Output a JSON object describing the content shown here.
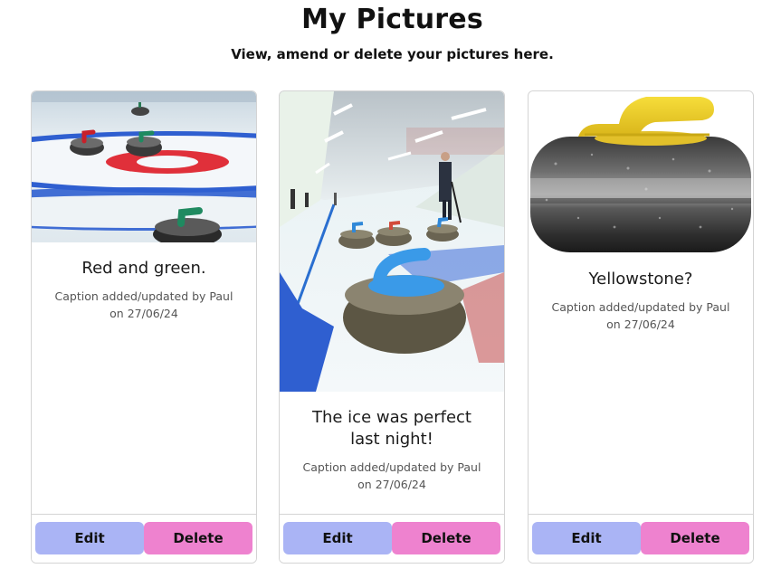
{
  "header": {
    "title": "My Pictures",
    "subtitle": "View, amend or delete your pictures here."
  },
  "cards": [
    {
      "image_icon": "curling-stones-red-green-photo",
      "caption": "Red and green.",
      "meta_line1": "Caption added/updated by Paul",
      "meta_line2": "on 27/06/24",
      "edit_label": "Edit",
      "delete_label": "Delete"
    },
    {
      "image_icon": "curling-rink-blue-stones-photo",
      "caption": "The ice was perfect last night!",
      "meta_line1": "Caption added/updated by Paul",
      "meta_line2": "on 27/06/24",
      "edit_label": "Edit",
      "delete_label": "Delete"
    },
    {
      "image_icon": "yellow-curling-stone-photo",
      "caption": "Yellowstone?",
      "meta_line1": "Caption added/updated by Paul",
      "meta_line2": "on 27/06/24",
      "edit_label": "Edit",
      "delete_label": "Delete"
    }
  ],
  "colors": {
    "edit_button": "#aab4f5",
    "delete_button": "#ee82cf",
    "card_border": "#d4d4d4"
  }
}
